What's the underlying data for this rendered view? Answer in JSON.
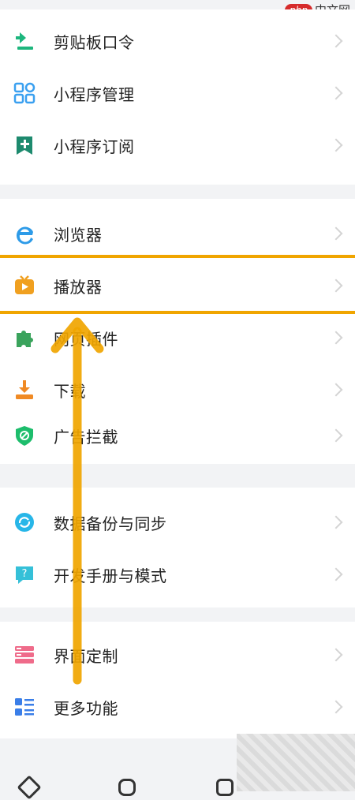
{
  "watermark": {
    "logo": "php",
    "text": "中文网"
  },
  "groups": [
    {
      "items": [
        {
          "label": "剪贴板口令",
          "icon": "clipboard-download-icon",
          "color": "#1db67d"
        },
        {
          "label": "小程序管理",
          "icon": "grid-apps-icon",
          "color": "#3aa0f0"
        },
        {
          "label": "小程序订阅",
          "icon": "bookmark-plus-icon",
          "color": "#1d8a6e"
        }
      ]
    },
    {
      "items": [
        {
          "label": "浏览器",
          "icon": "browser-e-icon",
          "color": "#2d9be8"
        },
        {
          "label": "播放器",
          "icon": "tv-play-icon",
          "color": "#f0a020"
        },
        {
          "label": "网页插件",
          "icon": "puzzle-icon",
          "color": "#3aa35c"
        },
        {
          "label": "下载",
          "icon": "download-icon",
          "color": "#f08a24"
        },
        {
          "label": "广告拦截",
          "icon": "shield-block-icon",
          "color": "#1dbd6c"
        }
      ]
    },
    {
      "items": [
        {
          "label": "数据备份与同步",
          "icon": "cloud-sync-icon",
          "color": "#27b6e8"
        },
        {
          "label": "开发手册与模式",
          "icon": "help-chat-icon",
          "color": "#35c0d8"
        }
      ]
    },
    {
      "items": [
        {
          "label": "界面定制",
          "icon": "layout-custom-icon",
          "color": "#ef6b8a"
        },
        {
          "label": "更多功能",
          "icon": "list-more-icon",
          "color": "#3a7ee8"
        }
      ]
    }
  ],
  "highlight_color": "#f0a500"
}
